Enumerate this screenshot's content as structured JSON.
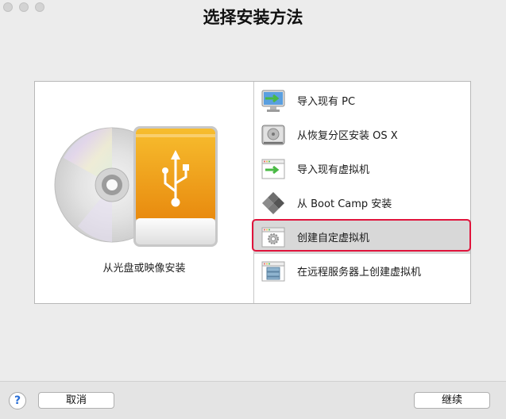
{
  "window": {
    "title": "选择安装方法"
  },
  "left_pane": {
    "label": "从光盘或映像安装"
  },
  "options": [
    {
      "label": "导入现有 PC",
      "icon": "pc-monitor-import-icon"
    },
    {
      "label": "从恢复分区安装 OS X",
      "icon": "hard-disk-icon"
    },
    {
      "label": "导入现有虚拟机",
      "icon": "window-import-icon"
    },
    {
      "label": "从 Boot Camp 安装",
      "icon": "boot-camp-diamond-icon"
    },
    {
      "label": "创建自定虚拟机",
      "icon": "gear-window-icon",
      "selected": true
    },
    {
      "label": "在远程服务器上创建虚拟机",
      "icon": "server-window-icon"
    }
  ],
  "footer": {
    "help_label": "?",
    "cancel_label": "取消",
    "continue_label": "继续"
  },
  "colors": {
    "highlight": "#e0143c",
    "selected_row": "#d8d8d8",
    "usb_orange": "#f2a21b"
  }
}
